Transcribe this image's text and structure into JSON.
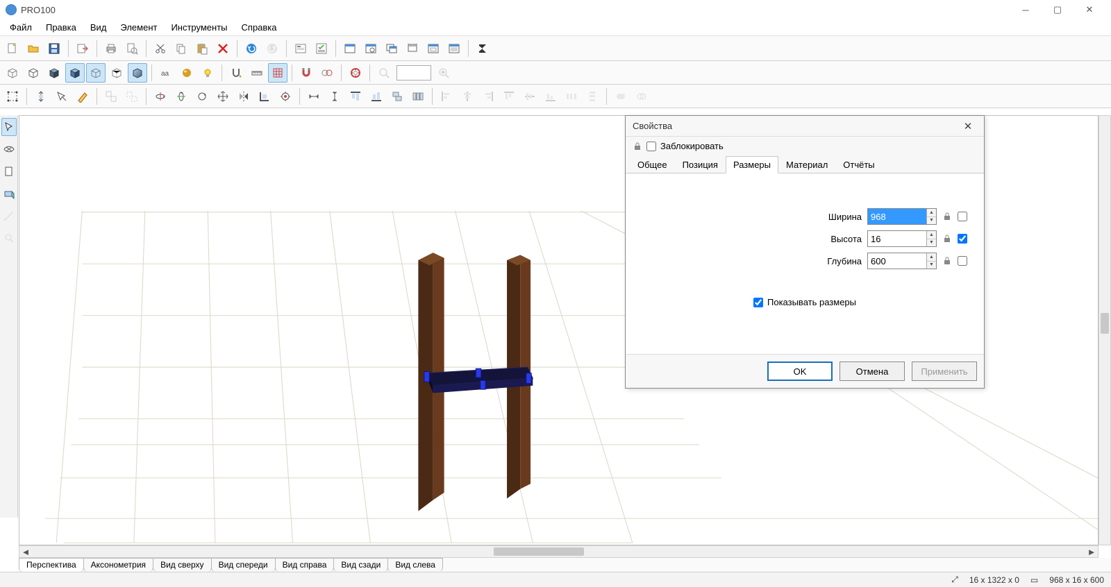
{
  "app": {
    "title": "PRO100"
  },
  "menu": {
    "items": [
      "Файл",
      "Правка",
      "Вид",
      "Элемент",
      "Инструменты",
      "Справка"
    ]
  },
  "viewTabs": [
    "Перспектива",
    "Аксонометрия",
    "Вид сверху",
    "Вид спереди",
    "Вид справа",
    "Вид сзади",
    "Вид слева"
  ],
  "status": {
    "pos": "16 x 1322 x 0",
    "size": "968 x 16 x 600"
  },
  "dialog": {
    "title": "Свойства",
    "lockLabel": "Заблокировать",
    "tabs": [
      "Общее",
      "Позиция",
      "Размеры",
      "Материал",
      "Отчёты"
    ],
    "activeTab": 2,
    "fields": {
      "widthLabel": "Ширина",
      "widthValue": "968",
      "heightLabel": "Высота",
      "heightValue": "16",
      "depthLabel": "Глубина",
      "depthValue": "600"
    },
    "heightLocked": true,
    "showDimsLabel": "Показывать размеры",
    "buttons": {
      "ok": "OK",
      "cancel": "Отмена",
      "apply": "Применить"
    }
  }
}
